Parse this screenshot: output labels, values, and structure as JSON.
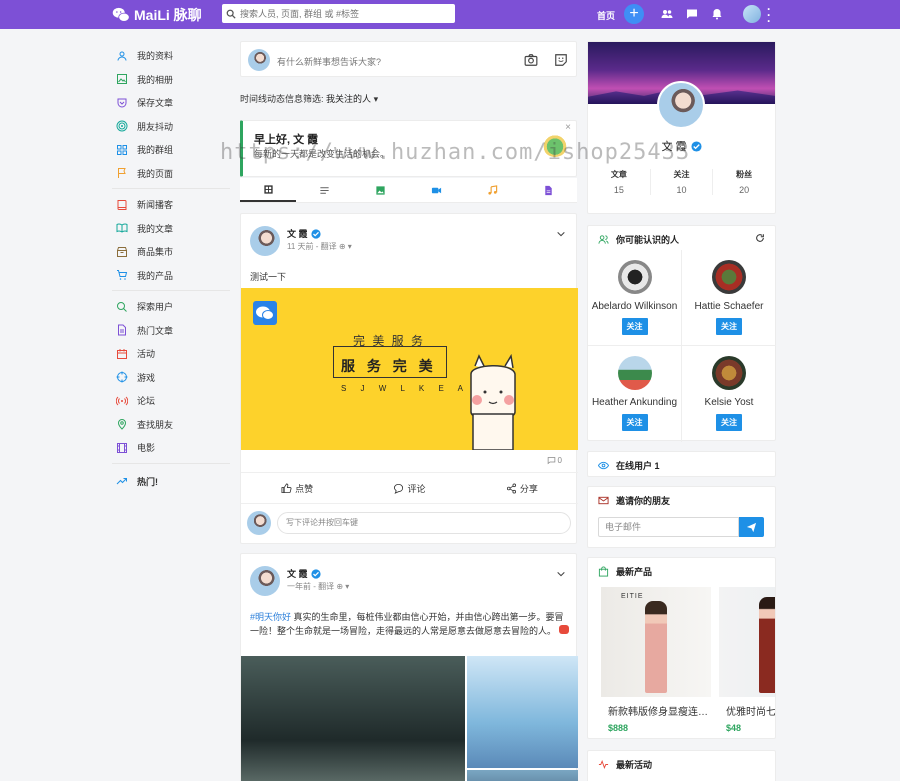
{
  "app": {
    "logo_text": "MaiLi 脉聊",
    "search_placeholder": "搜索人员, 页面, 群组 或 #标签",
    "home_label": "首页",
    "plus_label": "+"
  },
  "colors": {
    "brand": "#7d50d6",
    "accent": "#1e90e6",
    "green": "#2ea55f"
  },
  "sidebar": {
    "group1": [
      {
        "label": "我的资料",
        "icon": "user-icon",
        "color": "#1e90e6"
      },
      {
        "label": "我的相册",
        "icon": "photo-icon",
        "color": "#2ea55f"
      },
      {
        "label": "保存文章",
        "icon": "bookmark-icon",
        "color": "#7d50d6"
      },
      {
        "label": "朋友抖动",
        "icon": "target-icon",
        "color": "#14a89a"
      },
      {
        "label": "我的群组",
        "icon": "grid-icon",
        "color": "#1e90e6"
      },
      {
        "label": "我的页面",
        "icon": "flag-icon",
        "color": "#f0a030"
      }
    ],
    "group2": [
      {
        "label": "新闻播客",
        "icon": "book-icon",
        "color": "#e74a3b"
      },
      {
        "label": "我的文章",
        "icon": "open-book-icon",
        "color": "#14a89a"
      },
      {
        "label": "商品集市",
        "icon": "shop-icon",
        "color": "#8a6d3b"
      },
      {
        "label": "我的产品",
        "icon": "cart-icon",
        "color": "#1e90e6"
      }
    ],
    "group3": [
      {
        "label": "探索用户",
        "icon": "search-icon",
        "color": "#2ea55f"
      },
      {
        "label": "热门文章",
        "icon": "doc-icon",
        "color": "#7d50d6"
      },
      {
        "label": "活动",
        "icon": "calendar-icon",
        "color": "#e74a3b"
      },
      {
        "label": "游戏",
        "icon": "crosshair-icon",
        "color": "#1e90e6"
      },
      {
        "label": "论坛",
        "icon": "broadcast-icon",
        "color": "#e74a3b"
      },
      {
        "label": "查找朋友",
        "icon": "location-icon",
        "color": "#2ea55f"
      },
      {
        "label": "电影",
        "icon": "film-icon",
        "color": "#7d50d6"
      }
    ],
    "hot_label": "热门!"
  },
  "composer": {
    "placeholder": "有什么新鲜事想告诉大家?"
  },
  "filter": {
    "prefix": "时间线动态信息筛选:",
    "value": "我关注的人"
  },
  "greeting": {
    "title": "早上好, 文 霞",
    "subtitle": "每新的一天都是改变生活的机会。",
    "close": "×"
  },
  "posts": [
    {
      "author": "文 霞",
      "meta": "11 天前 - 翻译",
      "text": "测试一下",
      "banner": {
        "line1": "完 美 服 务",
        "line2": "服 务 完 美",
        "line3": "S J W L K E A"
      },
      "comment_count": "0",
      "like_label": "点赞",
      "comment_label": "评论",
      "share_label": "分享",
      "comment_placeholder": "写下评论并按回车键"
    },
    {
      "author": "文 霞",
      "meta": "一年前 - 翻译",
      "hashtag": "#明天你好",
      "text": "真实的生命里，每桩伟业都由信心开始，并由信心跨出第一步。要冒一险！整个生命就是一场冒险，走得最远的人常是愿意去做愿意去冒险的人。"
    }
  ],
  "profile": {
    "name": "文 霞",
    "stats": [
      {
        "label": "文章",
        "value": "15"
      },
      {
        "label": "关注",
        "value": "10"
      },
      {
        "label": "粉丝",
        "value": "20"
      }
    ]
  },
  "suggest": {
    "title": "你可能认识的人",
    "follow_label": "关注",
    "people": [
      {
        "name": "Abelardo Wilkinson"
      },
      {
        "name": "Hattie Schaefer"
      },
      {
        "name": "Heather Ankunding"
      },
      {
        "name": "Kelsie Yost"
      }
    ]
  },
  "online": {
    "title": "在线用户 1"
  },
  "invite": {
    "title": "邀请你的朋友",
    "placeholder": "电子邮件"
  },
  "products": {
    "title": "最新产品",
    "items": [
      {
        "name": "新款韩版修身显瘦连衣裙",
        "price": "$888",
        "brand": "EITIE"
      },
      {
        "name": "优雅时尚七分袖连衣裙",
        "price": "$48",
        "brand": ""
      }
    ]
  },
  "events": {
    "title": "最新活动"
  },
  "watermark": "https://www.huzhan.com/ishop25433"
}
